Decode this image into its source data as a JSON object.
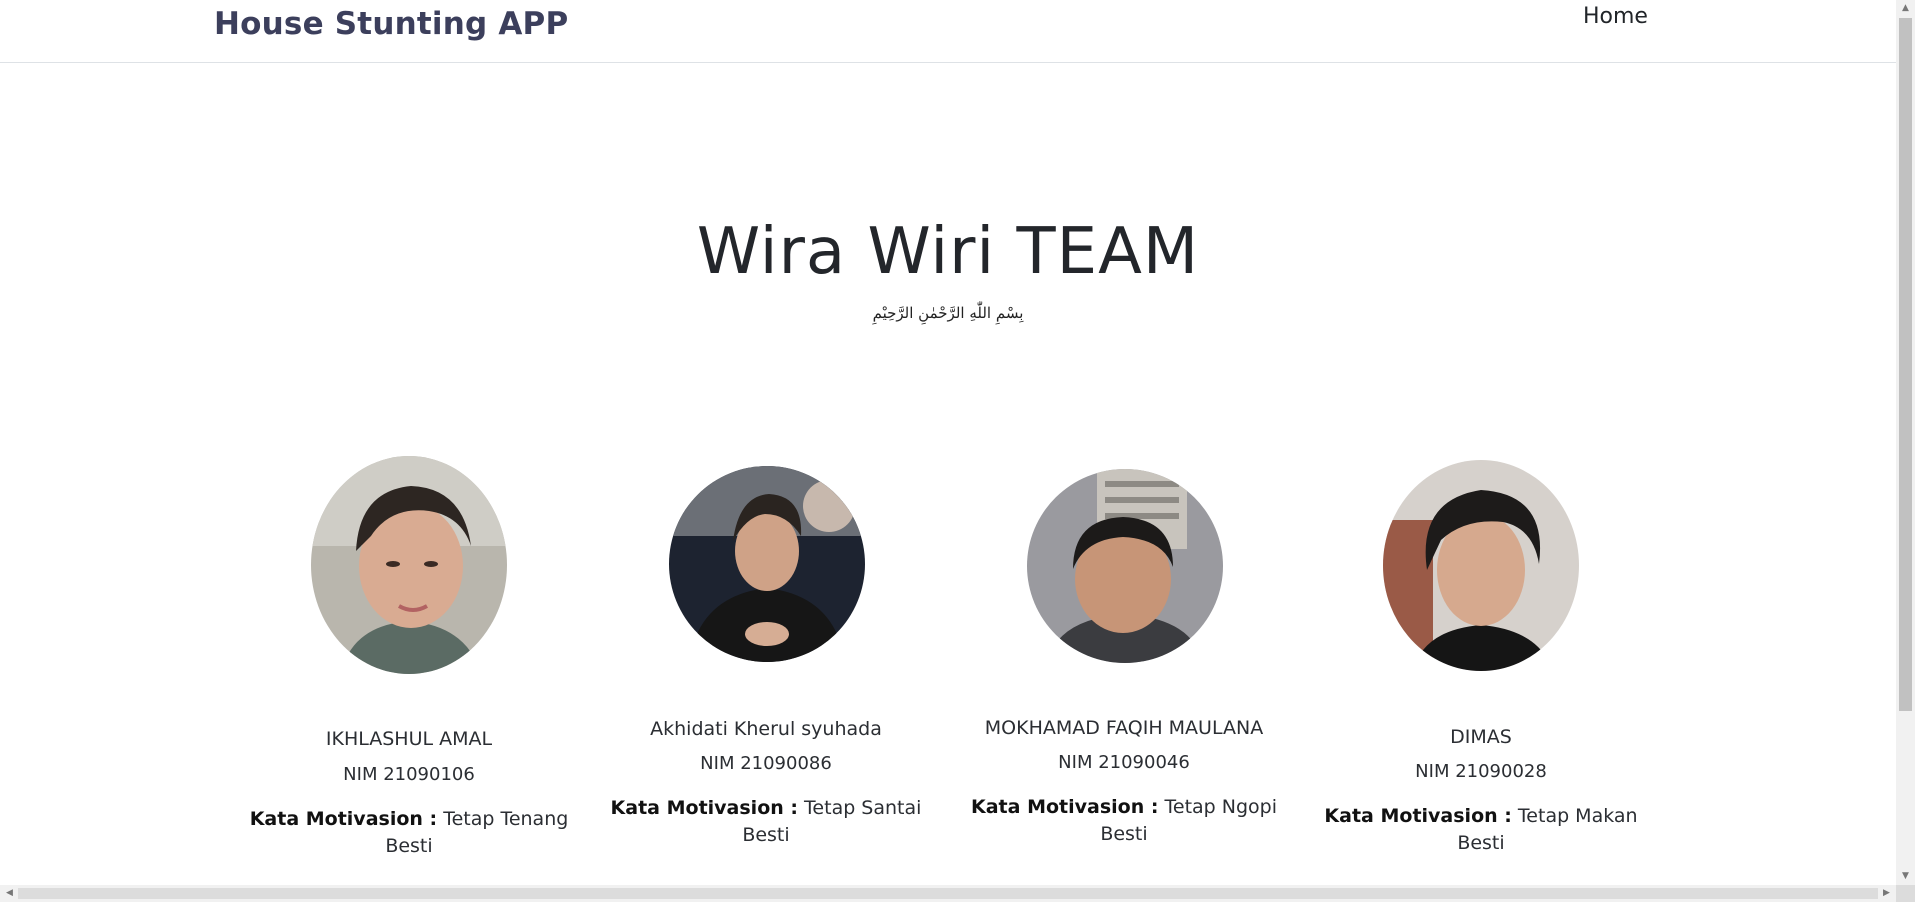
{
  "navbar": {
    "brand": "House Stunting APP",
    "home_label": "Home"
  },
  "hero": {
    "title": "Wira Wiri TEAM",
    "subtitle": "بِسْمِ اللّٰهِ الرَّحْمٰنِ الرَّحِيْمِ"
  },
  "team": [
    {
      "name": "IKHLASHUL AMAL",
      "nim": "NIM 21090106",
      "quote_label": "Kata Motivasion :",
      "quote": "Tetap Tenang Besti"
    },
    {
      "name": "Akhidati Kherul syuhada",
      "nim": "NIM 21090086",
      "quote_label": "Kata Motivasion :",
      "quote": "Tetap Santai Besti"
    },
    {
      "name": "MOKHAMAD FAQIH MAULANA",
      "nim": "NIM 21090046",
      "quote_label": "Kata Motivasion :",
      "quote": "Tetap Ngopi Besti"
    },
    {
      "name": "DIMAS",
      "nim": "NIM 21090028",
      "quote_label": "Kata Motivasion :",
      "quote": "Tetap Makan Besti"
    }
  ]
}
